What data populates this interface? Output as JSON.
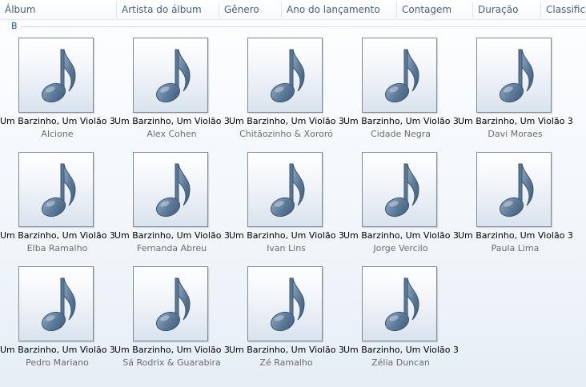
{
  "columns": [
    {
      "label": "Álbum"
    },
    {
      "label": "Artista do álbum"
    },
    {
      "label": "Gênero"
    },
    {
      "label": "Ano do lançamento"
    },
    {
      "label": "Contagem"
    },
    {
      "label": "Duração"
    },
    {
      "label": "Classificação"
    }
  ],
  "group": {
    "label": "B"
  },
  "albums": [
    {
      "title": "Um Barzinho, Um Violão 3",
      "artist": "Alcione"
    },
    {
      "title": "Um Barzinho, Um Violão 3",
      "artist": "Alex Cohen"
    },
    {
      "title": "Um Barzinho, Um Violão 3",
      "artist": "Chitãozinho & Xororó"
    },
    {
      "title": "Um Barzinho, Um Violão 3",
      "artist": "Cidade Negra"
    },
    {
      "title": "Um Barzinho, Um Violão 3",
      "artist": "Davi Moraes"
    },
    {
      "title": "Um Barzinho, Um Violão 3",
      "artist": "Elba Ramalho"
    },
    {
      "title": "Um Barzinho, Um Violão 3",
      "artist": "Fernanda Abreu"
    },
    {
      "title": "Um Barzinho, Um Violão 3",
      "artist": "Ivan Lins"
    },
    {
      "title": "Um Barzinho, Um Violão 3",
      "artist": "Jorge Vercilo"
    },
    {
      "title": "Um Barzinho, Um Violão 3",
      "artist": "Paula Lima"
    },
    {
      "title": "Um Barzinho, Um Violão 3",
      "artist": "Pedro Mariano"
    },
    {
      "title": "Um Barzinho, Um Violão 3",
      "artist": "Sá Rodrix & Guarabira"
    },
    {
      "title": "Um Barzinho, Um Violão 3",
      "artist": "Zé Ramalho"
    },
    {
      "title": "Um Barzinho, Um Violão 3",
      "artist": "Zélia Duncan"
    }
  ],
  "icons": {
    "album_art": "music-note-icon"
  },
  "colors": {
    "group_label": "#1e4fa8",
    "note_fill": "#5b7897",
    "artist_text": "#6b6b6b"
  }
}
